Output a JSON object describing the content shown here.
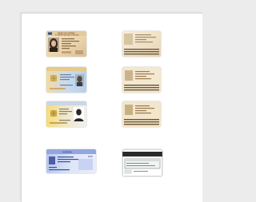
{
  "document": {
    "title": "",
    "cards": [
      {
        "id": "dni-old-front",
        "header": "REINO DE ESPAÑA",
        "subheader": "DOCUMENTO NACIONAL DE IDENTIDAD",
        "country": "ESP"
      },
      {
        "id": "dni-old-back"
      },
      {
        "id": "dni-mid-front"
      },
      {
        "id": "dni-mid-back"
      },
      {
        "id": "dni-new-front"
      },
      {
        "id": "dni-new-back"
      },
      {
        "id": "dni-blue-front",
        "country": "ESPAÑA",
        "label_left": "ESP"
      },
      {
        "id": "dni-blue-back"
      }
    ]
  }
}
